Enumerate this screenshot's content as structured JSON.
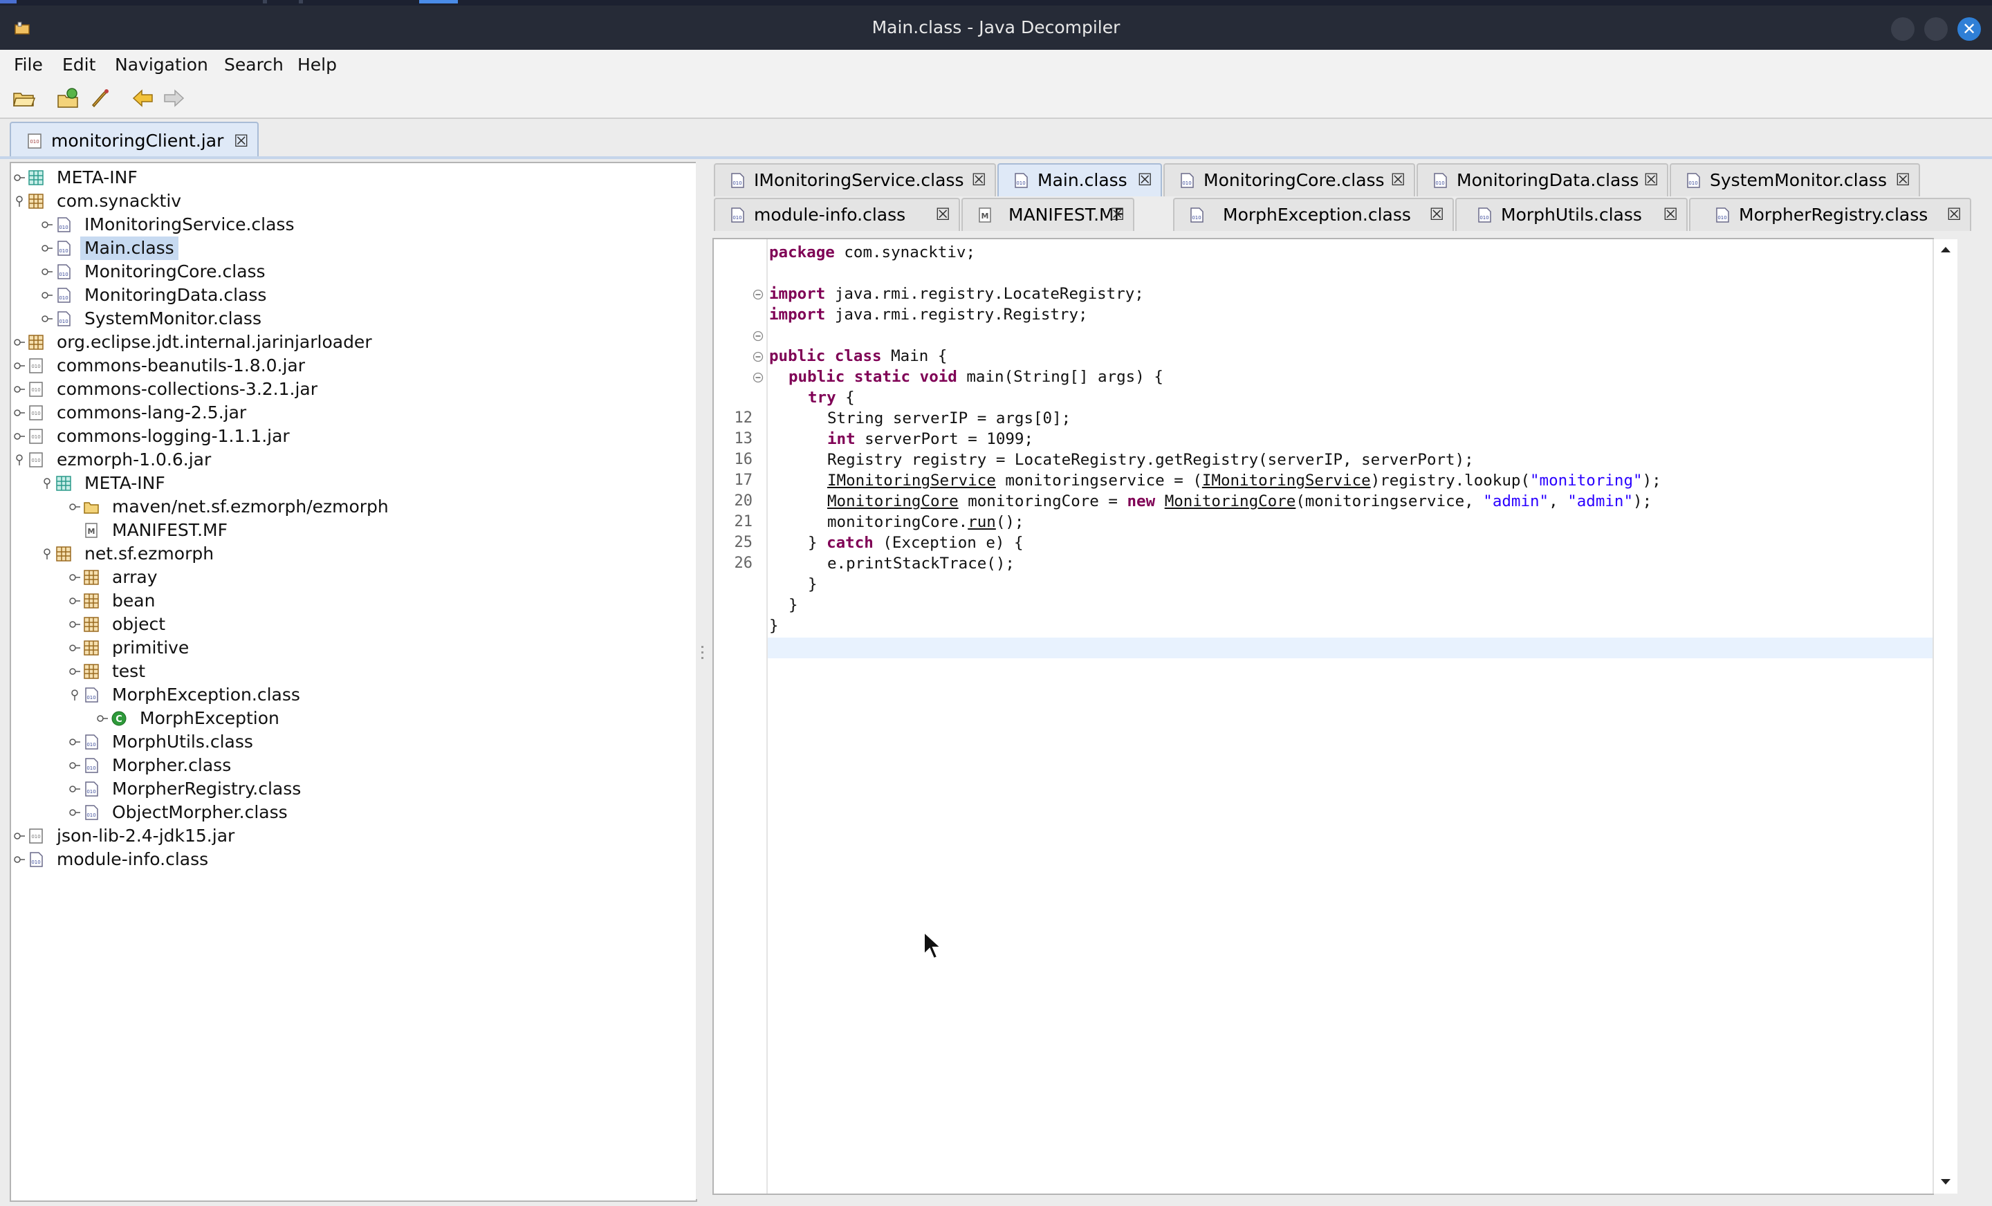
{
  "window": {
    "title": "Main.class - Java Decompiler"
  },
  "menu": {
    "items": [
      "File",
      "Edit",
      "Navigation",
      "Search",
      "Help"
    ]
  },
  "toolbar": {
    "buttons": [
      "open-file-icon",
      "open-type-icon",
      "search-icon",
      "back-arrow-icon",
      "forward-arrow-icon"
    ]
  },
  "file_tab": {
    "label": "monitoringClient.jar"
  },
  "tree": {
    "nodes": [
      {
        "label": "META-INF",
        "icon": "folder-package-icon"
      },
      {
        "label": "com.synacktiv",
        "icon": "package-icon"
      },
      {
        "label": "IMonitoringService.class",
        "icon": "class-file-icon"
      },
      {
        "label": "Main.class",
        "icon": "class-file-icon"
      },
      {
        "label": "MonitoringCore.class",
        "icon": "class-file-icon"
      },
      {
        "label": "MonitoringData.class",
        "icon": "class-file-icon"
      },
      {
        "label": "SystemMonitor.class",
        "icon": "class-file-icon"
      },
      {
        "label": "org.eclipse.jdt.internal.jarinjarloader",
        "icon": "package-icon"
      },
      {
        "label": "commons-beanutils-1.8.0.jar",
        "icon": "jar-icon"
      },
      {
        "label": "commons-collections-3.2.1.jar",
        "icon": "jar-icon"
      },
      {
        "label": "commons-lang-2.5.jar",
        "icon": "jar-icon"
      },
      {
        "label": "commons-logging-1.1.1.jar",
        "icon": "jar-icon"
      },
      {
        "label": "ezmorph-1.0.6.jar",
        "icon": "jar-icon"
      },
      {
        "label": "META-INF",
        "icon": "folder-package-icon"
      },
      {
        "label": "maven/net.sf.ezmorph/ezmorph",
        "icon": "folder-icon"
      },
      {
        "label": "MANIFEST.MF",
        "icon": "manifest-icon"
      },
      {
        "label": "net.sf.ezmorph",
        "icon": "package-icon"
      },
      {
        "label": "array",
        "icon": "package-icon"
      },
      {
        "label": "bean",
        "icon": "package-icon"
      },
      {
        "label": "object",
        "icon": "package-icon"
      },
      {
        "label": "primitive",
        "icon": "package-icon"
      },
      {
        "label": "test",
        "icon": "package-icon"
      },
      {
        "label": "MorphException.class",
        "icon": "class-file-icon"
      },
      {
        "label": "MorphException",
        "icon": "class-icon"
      },
      {
        "label": "MorphUtils.class",
        "icon": "class-file-icon"
      },
      {
        "label": "Morpher.class",
        "icon": "class-file-icon"
      },
      {
        "label": "MorpherRegistry.class",
        "icon": "class-file-icon"
      },
      {
        "label": "ObjectMorpher.class",
        "icon": "class-file-icon"
      },
      {
        "label": "json-lib-2.4-jdk15.jar",
        "icon": "jar-icon"
      },
      {
        "label": "module-info.class",
        "icon": "class-file-icon"
      }
    ]
  },
  "editor_tabs": {
    "row1": [
      "IMonitoringService.class",
      "Main.class",
      "MonitoringCore.class",
      "MonitoringData.class",
      "SystemMonitor.class"
    ],
    "row2": [
      "module-info.class",
      "MANIFEST.MF",
      "MorphException.class",
      "MorphUtils.class",
      "MorpherRegistry.class"
    ],
    "active": "Main.class"
  },
  "code": {
    "line_numbers": [
      "12",
      "13",
      "16",
      "17",
      "20",
      "21",
      "25",
      "26"
    ],
    "t_package": "package",
    "t_pkgname": " com.synacktiv;",
    "t_import": "import",
    "t_imp1": " java.rmi.registry.LocateRegistry;",
    "t_imp2": " java.rmi.registry.Registry;",
    "t_public": "public",
    "t_class": "class",
    "t_main_decl": " Main {",
    "t_static": "static",
    "t_void": "void",
    "t_main_sig": " main(String[] args) {",
    "t_try": "try",
    "t_brace_open": " {",
    "t_l12": "String serverIP = args[0];",
    "t_int": "int",
    "t_l13": " serverPort = 1099;",
    "t_l16": "Registry registry = LocateRegistry.getRegistry(serverIP, serverPort);",
    "t_ims": "IMonitoringService",
    "t_l17a": " monitoringservice = (",
    "t_l17b": ")registry.lookup(",
    "t_str_monitoring": "\"monitoring\"",
    "t_l17c": ");",
    "t_mc": "MonitoringCore",
    "t_l20a": " monitoringCore = ",
    "t_new": "new",
    "t_l20b": "(monitoringservice, ",
    "t_str_admin": "\"admin\"",
    "t_comma": ", ",
    "t_l20c": ");",
    "t_l21a": "monitoringCore.",
    "t_run": "run",
    "t_l21b": "();",
    "t_catch_pre": "} ",
    "t_catch": "catch",
    "t_catch_post": " (Exception e) {",
    "t_l26": "e.printStackTrace();",
    "t_close": "}"
  }
}
